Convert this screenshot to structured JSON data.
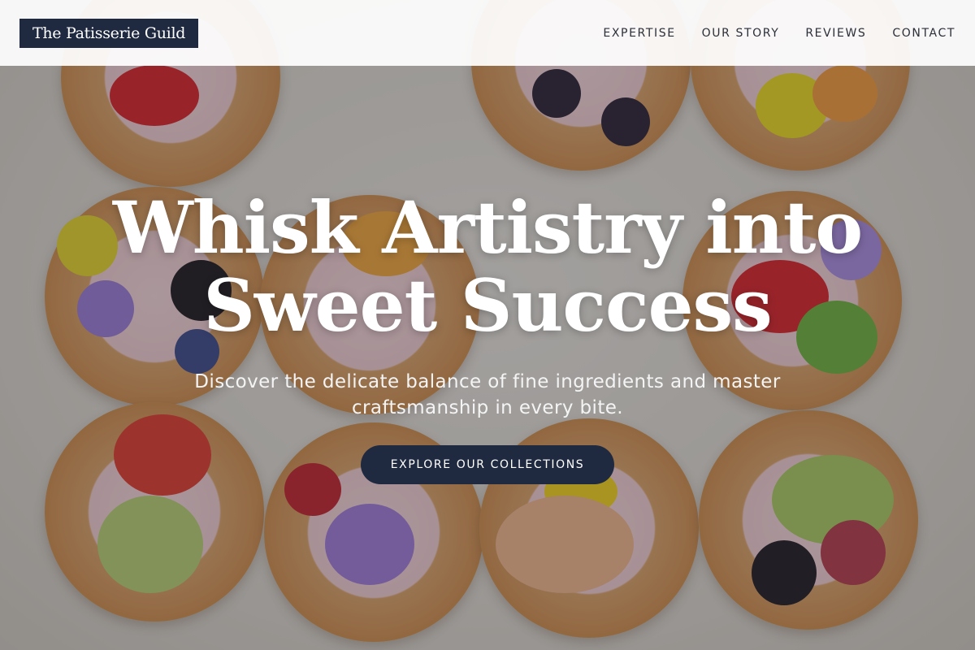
{
  "header": {
    "brand": "The Patisserie Guild",
    "nav": [
      {
        "label": "EXPERTISE"
      },
      {
        "label": "OUR STORY"
      },
      {
        "label": "REVIEWS"
      },
      {
        "label": "CONTACT"
      }
    ]
  },
  "hero": {
    "title_line1": "Whisk Artistry into",
    "title_line2": "Sweet Success",
    "subtitle": "Discover the delicate balance of fine ingredients and master craftsmanship in every bite.",
    "cta_label": "EXPLORE OUR COLLECTIONS",
    "background_image": "tarts-with-fruit-and-flowers"
  },
  "colors": {
    "brand_navy": "#1f2a40",
    "nav_bg": "#ffffff",
    "text_light": "#ffffff"
  }
}
